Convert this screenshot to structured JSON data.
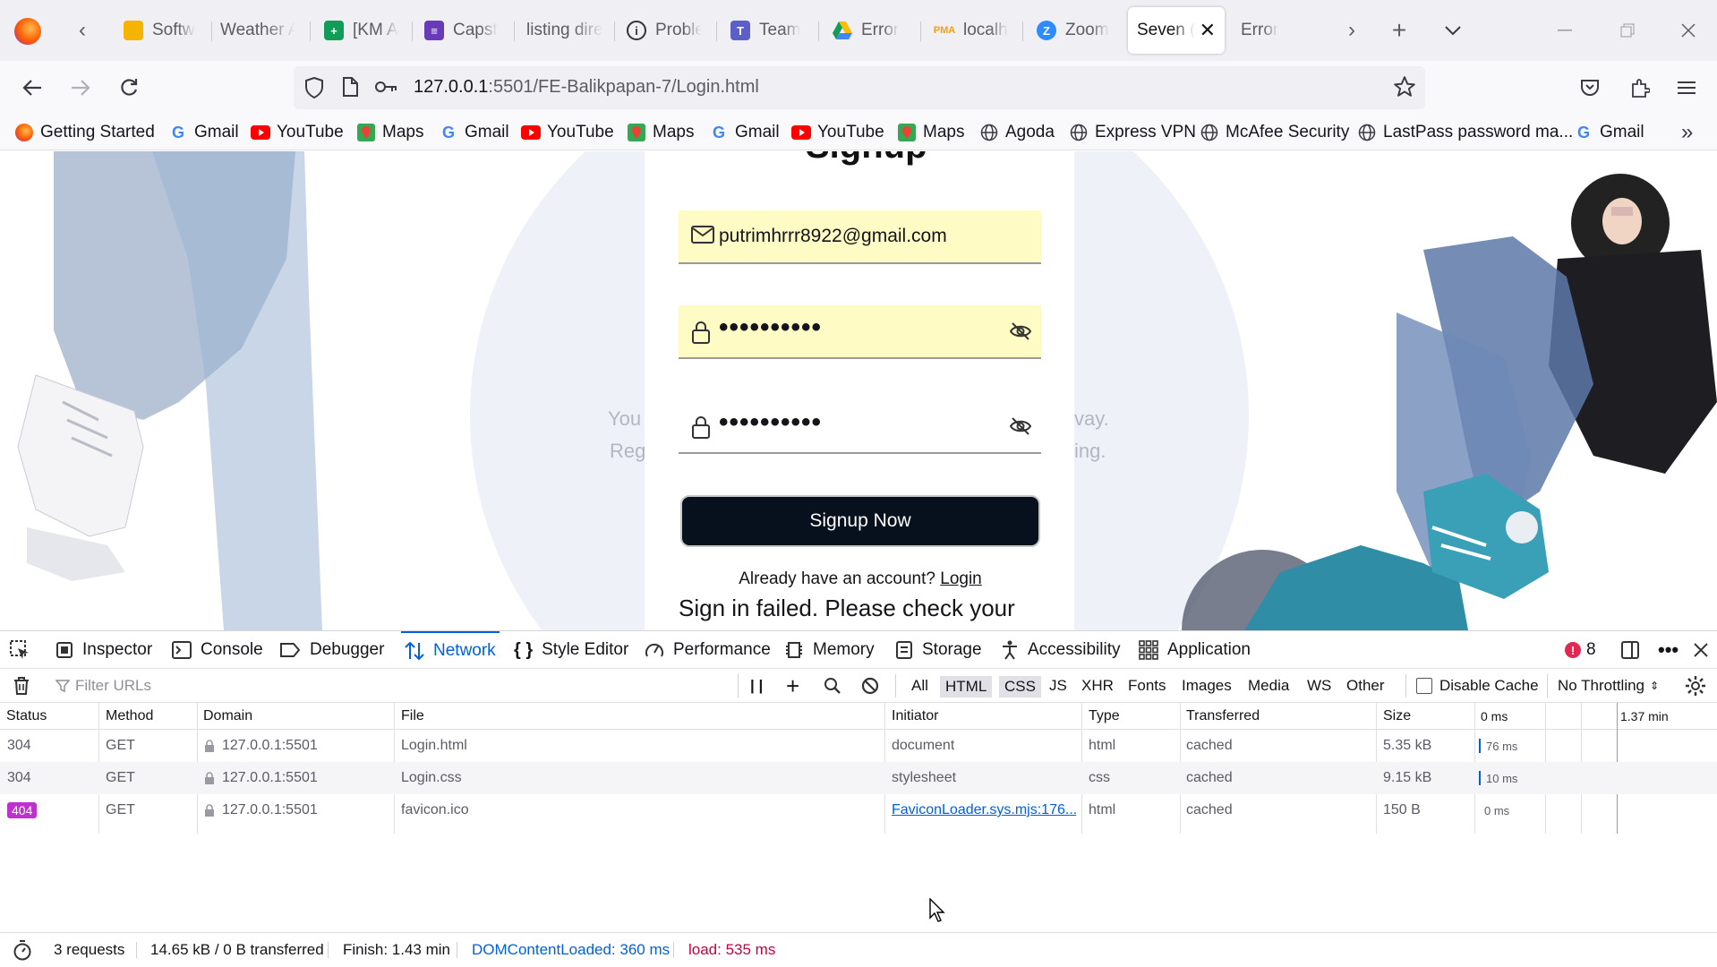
{
  "tabs": [
    {
      "label": "Softw",
      "icon": "slides-icon",
      "color": "#f4b400"
    },
    {
      "label": "Weather A",
      "icon": "",
      "color": ""
    },
    {
      "label": "[KM A",
      "icon": "sheets-icon",
      "color": "#0f9d58"
    },
    {
      "label": "Capst",
      "icon": "forms-icon",
      "color": "#673ab7"
    },
    {
      "label": "listing dire",
      "icon": "",
      "color": ""
    },
    {
      "label": "Proble",
      "icon": "info-icon",
      "color": "#333333"
    },
    {
      "label": "Team",
      "icon": "teams-icon",
      "color": "#5b5fc7"
    },
    {
      "label": "Error",
      "icon": "drive-icon",
      "color": "#1a73e8"
    },
    {
      "label": "localh",
      "icon": "pma-icon",
      "color": "#f89c0e"
    },
    {
      "label": "Zoom",
      "icon": "zoom-icon",
      "color": "#2d8cff"
    },
    {
      "label": "Seven (",
      "icon": "",
      "color": "",
      "active": true
    },
    {
      "label": "Error",
      "icon": "",
      "color": ""
    }
  ],
  "nav": {
    "url_host": "127.0.0.1",
    "url_rest": ":5501/FE-Balikpapan-7/Login.html"
  },
  "bookmarks": [
    {
      "label": "Getting Started",
      "icon": "firefox-icon"
    },
    {
      "label": "Gmail",
      "icon": "google-icon"
    },
    {
      "label": "YouTube",
      "icon": "youtube-icon"
    },
    {
      "label": "Maps",
      "icon": "maps-icon"
    },
    {
      "label": "Gmail",
      "icon": "google-icon"
    },
    {
      "label": "YouTube",
      "icon": "youtube-icon"
    },
    {
      "label": "Maps",
      "icon": "maps-icon"
    },
    {
      "label": "Gmail",
      "icon": "google-icon"
    },
    {
      "label": "YouTube",
      "icon": "youtube-icon"
    },
    {
      "label": "Maps",
      "icon": "maps-icon"
    },
    {
      "label": "Agoda",
      "icon": "globe-icon"
    },
    {
      "label": "Express VPN",
      "icon": "globe-icon"
    },
    {
      "label": "McAfee Security",
      "icon": "globe-icon"
    },
    {
      "label": "LastPass password ma...",
      "icon": "globe-icon"
    },
    {
      "label": "Gmail",
      "icon": "google-icon"
    }
  ],
  "page": {
    "heading": "Signup",
    "email_value": "putrimhrrr8922@gmail.com",
    "password_value": "••••••••••",
    "confirm_value": "••••••••••",
    "signup_button": "Signup Now",
    "already_text": "Already have an account?",
    "login_link": "Login",
    "fail_message": "Sign in failed. Please check your",
    "ghost_left_1": "You",
    "ghost_left_2": "Reg",
    "ghost_right_1": "vay.",
    "ghost_right_2": "ing."
  },
  "devtools": {
    "tabs": [
      "Inspector",
      "Console",
      "Debugger",
      "Network",
      "Style Editor",
      "Performance",
      "Memory",
      "Storage",
      "Accessibility",
      "Application"
    ],
    "selected_tab": "Network",
    "error_count": "8",
    "filter_placeholder": "Filter URLs",
    "filter_types": [
      "All",
      "HTML",
      "CSS",
      "JS",
      "XHR",
      "Fonts",
      "Images",
      "Media",
      "WS",
      "Other"
    ],
    "disable_cache": "Disable Cache",
    "throttling": "No Throttling",
    "columns": [
      "Status",
      "Method",
      "Domain",
      "File",
      "Initiator",
      "Type",
      "Transferred",
      "Size"
    ],
    "timeline_start": "0 ms",
    "timeline_end": "1.37 min",
    "rows": [
      {
        "status": "304",
        "method": "GET",
        "domain": "127.0.0.1:5501",
        "file": "Login.html",
        "initiator": "document",
        "type": "html",
        "transferred": "cached",
        "size": "5.35 kB",
        "time": "76 ms"
      },
      {
        "status": "304",
        "method": "GET",
        "domain": "127.0.0.1:5501",
        "file": "Login.css",
        "initiator": "stylesheet",
        "type": "css",
        "transferred": "cached",
        "size": "9.15 kB",
        "time": "10 ms"
      },
      {
        "status": "404",
        "method": "GET",
        "domain": "127.0.0.1:5501",
        "file": "favicon.ico",
        "initiator": "FaviconLoader.sys.mjs:176...",
        "type": "html",
        "transferred": "cached",
        "size": "150 B",
        "time": "0 ms"
      }
    ],
    "status_bar": {
      "requests": "3 requests",
      "transferred": "14.65 kB / 0 B transferred",
      "finish": "Finish: 1.43 min",
      "dom_loaded": "DOMContentLoaded: 360 ms",
      "load": "load: 535 ms"
    }
  },
  "colors": {
    "accent": "#0060df",
    "error_badge": "#c030d0",
    "autofill": "#fffbc4",
    "button": "#07111d"
  }
}
